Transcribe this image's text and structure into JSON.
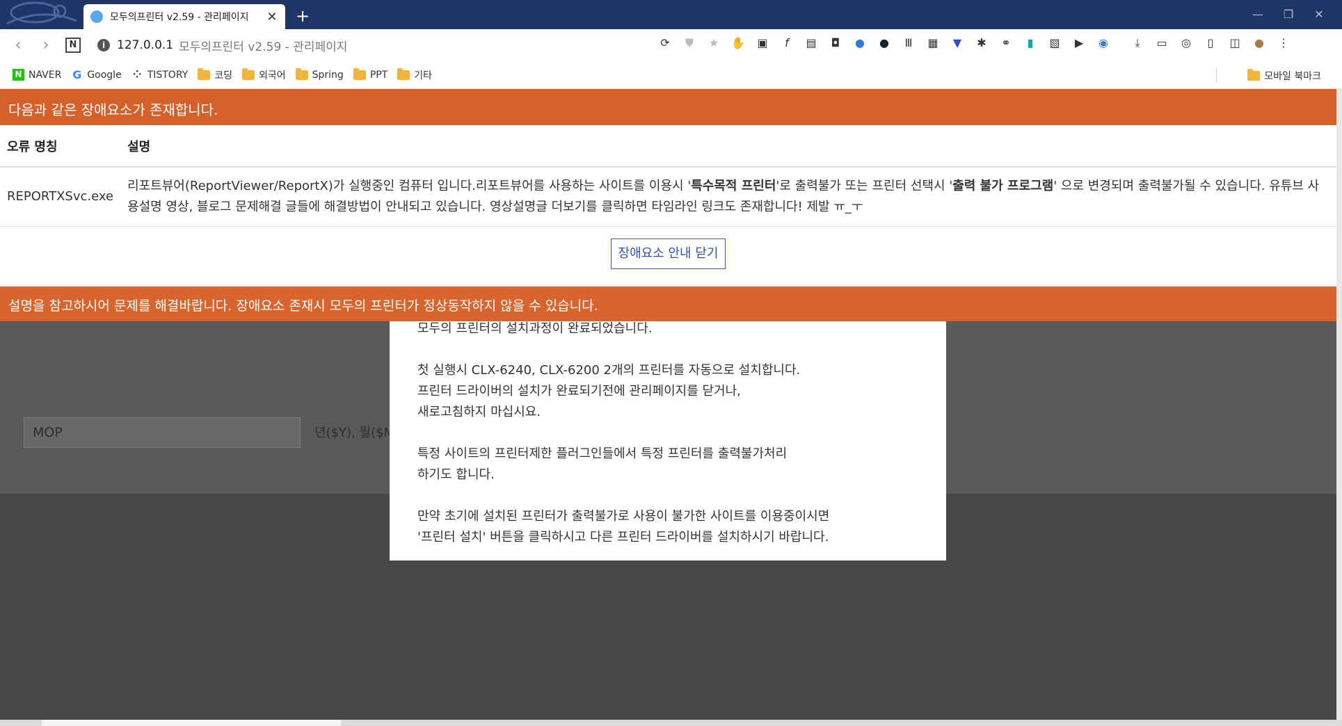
{
  "tab": {
    "title": "모두의프린터 v2.59 - 관리페이지",
    "close": "✕",
    "new_tab": "+"
  },
  "window": {
    "minimize": "—",
    "restore": "❐",
    "close": "✕"
  },
  "address": {
    "host": "127.0.0.1",
    "title": "모두의프린터 v2.59 - 관리페이지"
  },
  "bookmarks": {
    "items": [
      {
        "label": "NAVER",
        "icon": "naver-icon"
      },
      {
        "label": "Google",
        "icon": "google-icon"
      },
      {
        "label": "TISTORY",
        "icon": "tistory-icon"
      },
      {
        "label": "코딩",
        "icon": "folder-icon"
      },
      {
        "label": "외국어",
        "icon": "folder-icon"
      },
      {
        "label": "Spring",
        "icon": "folder-icon"
      },
      {
        "label": "PPT",
        "icon": "folder-icon"
      },
      {
        "label": "기타",
        "icon": "folder-icon"
      }
    ],
    "mobile": "모바일 북마크"
  },
  "fault": {
    "header": "다음과 같은 장애요소가 존재합니다.",
    "columns": {
      "name": "오류 명칭",
      "desc": "설명"
    },
    "rows": [
      {
        "name": "REPORTXSvc.exe",
        "desc_parts": [
          "리포트뷰어(ReportViewer/ReportX)가 실행중인 컴퓨터 입니다.리포트뷰어를 사용하는 사이트를 이용시 '",
          "특수목적 프린터",
          "'로 출력불가 또는 프린터 선택시 '",
          "출력 불가 프로그램",
          "' 으로 변경되며 출력불가될 수 있습니다. 유튜브 사용설명 영상, 블로그 문제해결 글들에 해결방법이 안내되고 있습니다. 영상설명글 더보기를 클릭하면 타임라인 링크도 존재합니다! 제발 ㅠ_ㅜ"
        ]
      }
    ],
    "close_button": "장애요소 안내 닫기",
    "footer": "설명을 참고하시어 문제를 해결바랍니다. 장애요소 존재시 모두의 프린터가 정상동작하지 않을 수 있습니다."
  },
  "background": {
    "input_value": "MOP",
    "hint": "년($Y), 월($M"
  },
  "modal": {
    "p1": "모두의 프린터의 설치과정이 완료되었습니다.",
    "p2_l1": "첫 실행시 CLX-6240, CLX-6200 2개의 프린터를 자동으로 설치합니다.",
    "p2_l2": "프린터 드라이버의 설치가 완료되기전에 관리페이지를 닫거나,",
    "p2_l3": "새로고침하지 마십시요.",
    "p3_l1": "특정 사이트의 프린터제한 플러그인들에서 특정 프린터를 출력불가처리",
    "p3_l2": "하기도 합니다.",
    "p4_l1": "만약 초기에 설치된 프린터가 출력불가로 사용이 불가한 사이트를 이용중이시면",
    "p4_l2": "'프린터 설치' 버튼을 클릭하시고 다른 프린터 드라이버를 설치하시기 바랍니다."
  }
}
